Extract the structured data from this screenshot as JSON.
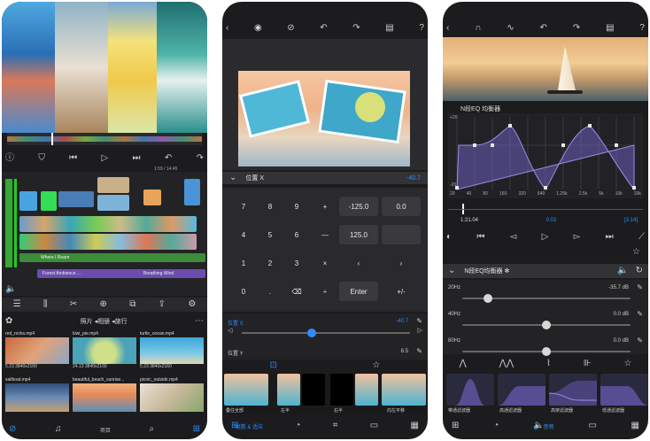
{
  "p1": {
    "time_label": "1:59 / 14:45",
    "tracks": [
      "Where I Roam",
      "Forest Ambience ...",
      "Breathing Wind"
    ],
    "browser_path": "照片 ◂相册 ◂旅行",
    "files": [
      {
        "name": "red_rocks.mp4",
        "meta": "5.23  3840x2160"
      },
      {
        "name": "kiwi_pie.mp4",
        "meta": "24.13  3840x2160"
      },
      {
        "name": "turtle_ocean.mp4",
        "meta": "5.23  3840x2160"
      },
      {
        "name": "sailboat.mp4",
        "meta": ""
      },
      {
        "name": "beautiful_beach_sunrise...",
        "meta": ""
      },
      {
        "name": "picnic_outside.mp4",
        "meta": ""
      }
    ],
    "bottom_label": "项目"
  },
  "p2": {
    "header": "位置 X",
    "header_value": "-40.7",
    "keys": [
      "7",
      "8",
      "9",
      "+",
      "4",
      "5",
      "6",
      "—",
      "1",
      "2",
      "3",
      "×",
      "0",
      ".",
      "⌫",
      "÷"
    ],
    "field_values": [
      "-125.0",
      "0.0",
      "125.0"
    ],
    "enter_label": "Enter",
    "plusminus_label": "+/-",
    "sliderx_label": "位置 X",
    "sliderx_value": "-40.7",
    "slidery_label": "位置 Y",
    "slidery_value": "8.5",
    "thumb_labels": [
      "叠往全部",
      "左半",
      "右半",
      "向左平移"
    ],
    "bottom_tab": "帧数 & 适应"
  },
  "p3": {
    "eq_title": "N段EQ 均衡器",
    "freq_labels": [
      "20",
      "40",
      "80",
      "160",
      "320",
      "640",
      "1.25k",
      "2.5k",
      "5k",
      "10k",
      "20k"
    ],
    "db_top": "+20",
    "db_bottom": "-20",
    "time_left": "1:21.04",
    "time_mid": "0.02",
    "time_right": "[3.14]",
    "panel_title": "N段EQ均衡器 ✻",
    "bands": [
      {
        "label": "20Hz",
        "value": "-35.7 dB",
        "level": 0.15
      },
      {
        "label": "40Hz",
        "value": "0.0 dB",
        "level": 0.5
      },
      {
        "label": "80Hz",
        "value": "0.0 dB",
        "level": 0.5
      }
    ],
    "filters": [
      "带通滤波器",
      "高通滤波器",
      "高架滤波器",
      "低通滤波器"
    ],
    "bottom_tab": "音频"
  }
}
